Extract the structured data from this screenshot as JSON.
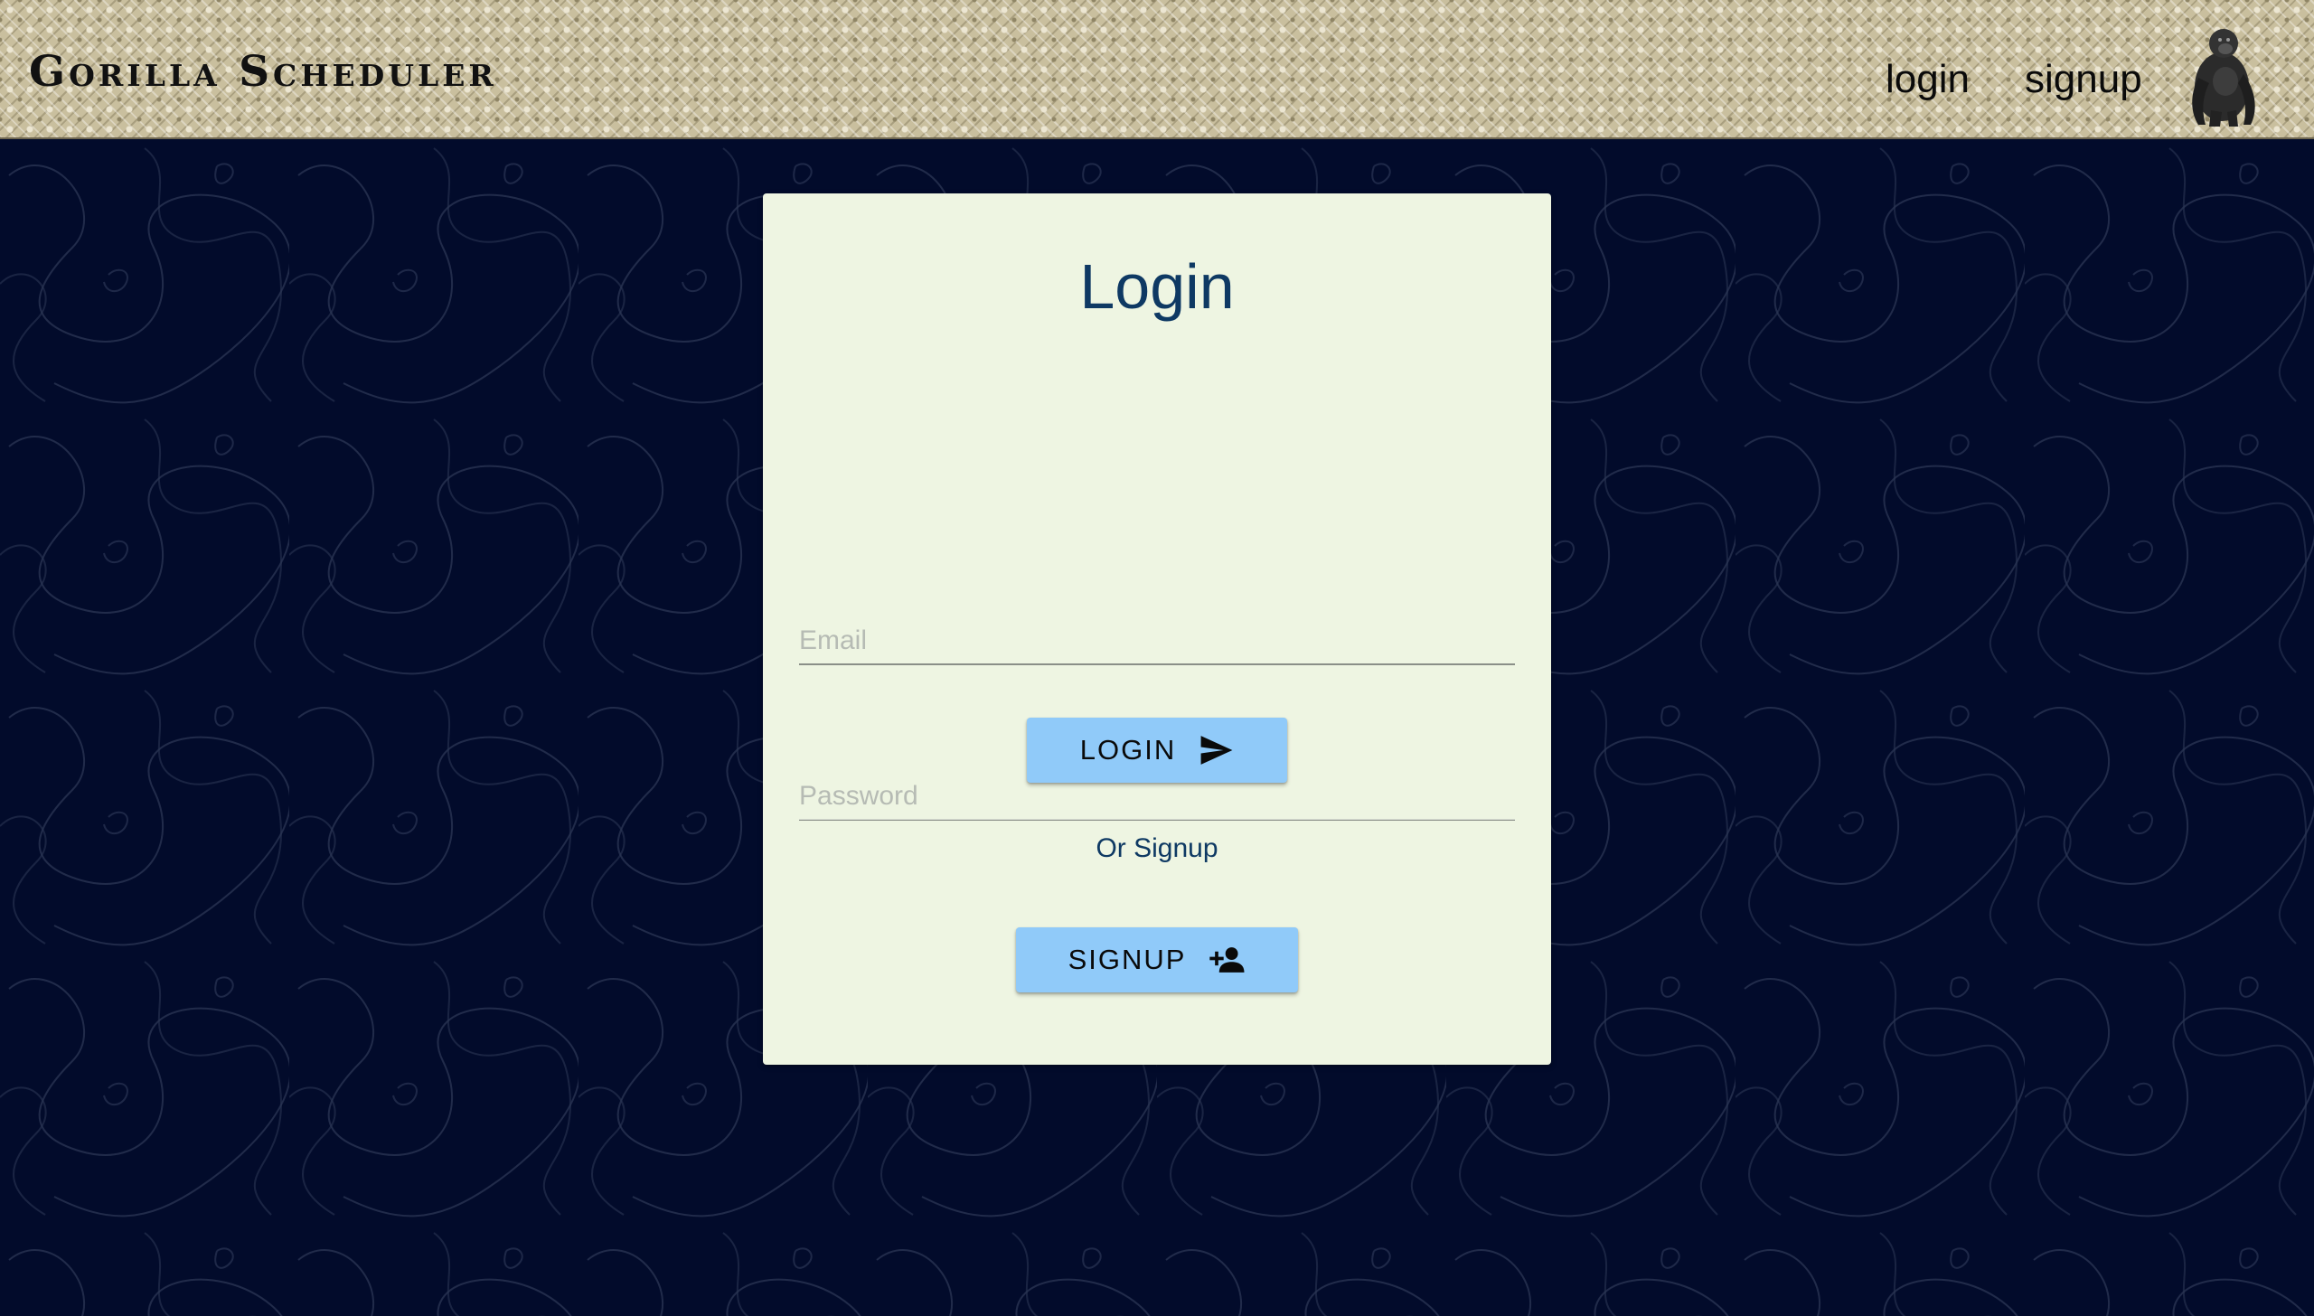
{
  "header": {
    "app_title": "Gorilla Scheduler",
    "nav": {
      "login_label": "login",
      "signup_label": "signup"
    },
    "logo_icon": "gorilla-icon"
  },
  "card": {
    "title": "Login",
    "email": {
      "placeholder": "Email",
      "value": ""
    },
    "password": {
      "placeholder": "Password",
      "value": ""
    },
    "login_button": {
      "label": "LOGIN",
      "icon": "send-icon"
    },
    "divider_text": "Or Signup",
    "signup_button": {
      "label": "SIGNUP",
      "icon": "person-add-icon"
    }
  },
  "colors": {
    "background": "#020b2b",
    "card": "#eef5e2",
    "button": "#90caf9",
    "title_text": "#0e3963",
    "header": "#c9bf9e"
  }
}
